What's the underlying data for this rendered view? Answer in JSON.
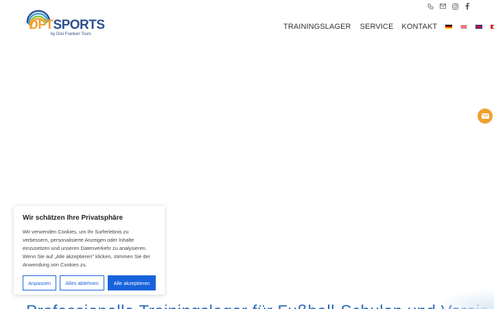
{
  "brand": {
    "logo_main": "DFT",
    "logo_accent": "SPORTS",
    "logo_sub": "by Drei Franken Tours"
  },
  "top_icons": [
    "phone-icon",
    "mail-icon",
    "instagram-icon",
    "facebook-icon"
  ],
  "nav": {
    "items": [
      "TRAININGSLAGER",
      "SERVICE",
      "KONTAKT"
    ],
    "languages": [
      "de",
      "at",
      "gb",
      "ch"
    ]
  },
  "cookie": {
    "title": "Wir schätzen Ihre Privatsphäre",
    "text": "Wir verwenden Cookies, um Ihr Surferlebnis zu verbessern, personalisierte Anzeigen oder Inhalte einzusetzen und unseren Datenverkehr zu analysieren. Wenn Sie auf „Alle akzeptieren\" klicken, stimmen Sie der Anwendung von Cookies zu.",
    "customize_label": "Anpassen",
    "reject_label": "Alles ablehnen",
    "accept_label": "Alle akzeptieren"
  },
  "headline": "Professionelle Trainingslager für Fußball-Schulen und Vereine",
  "colors": {
    "logo_orange": "#f3a033",
    "logo_blue": "#2c4f8c",
    "accent_orange": "#f0a02c",
    "cookie_blue": "#1863dc",
    "headline_blue": "#2b6bb8"
  }
}
